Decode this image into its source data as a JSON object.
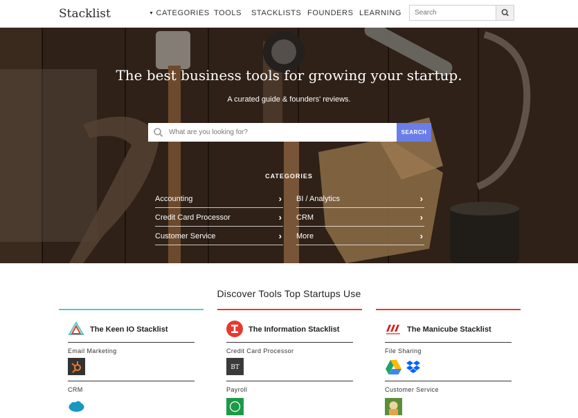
{
  "nav": {
    "logo": "Stacklist",
    "links": [
      "CATEGORIES",
      "TOOLS",
      "STACKLISTS",
      "FOUNDERS",
      "LEARNING"
    ],
    "search_placeholder": "Search"
  },
  "hero": {
    "title": "The best business tools for growing your startup.",
    "subtitle": "A curated guide & founders' reviews.",
    "search_placeholder": "What are you looking for?",
    "search_button": "SEARCH",
    "categories_heading": "CATEGORIES",
    "categories": [
      "Accounting",
      "BI / Analytics",
      "Credit Card Processor",
      "CRM",
      "Customer Service",
      "More"
    ]
  },
  "discover": {
    "title": "Discover Tools Top Startups Use",
    "columns": [
      {
        "title": "The Keen IO Stacklist",
        "accent": "#4ecdc4",
        "sections": [
          {
            "category": "Email Marketing",
            "tools": [
              "hubspot-icon"
            ]
          },
          {
            "category": "CRM",
            "tools": [
              "salesforce-icon"
            ]
          }
        ]
      },
      {
        "title": "The Information Stacklist",
        "accent": "#e8392f",
        "sections": [
          {
            "category": "Credit Card Processor",
            "tools": [
              "braintree-icon"
            ]
          },
          {
            "category": "Payroll",
            "tools": [
              "zenpayroll-icon"
            ]
          }
        ]
      },
      {
        "title": "The Manicube Stacklist",
        "accent": "#e8392f",
        "sections": [
          {
            "category": "File Sharing",
            "tools": [
              "google-drive-icon",
              "dropbox-icon"
            ]
          },
          {
            "category": "Customer Service",
            "tools": [
              "zendesk-icon"
            ]
          }
        ]
      }
    ]
  }
}
